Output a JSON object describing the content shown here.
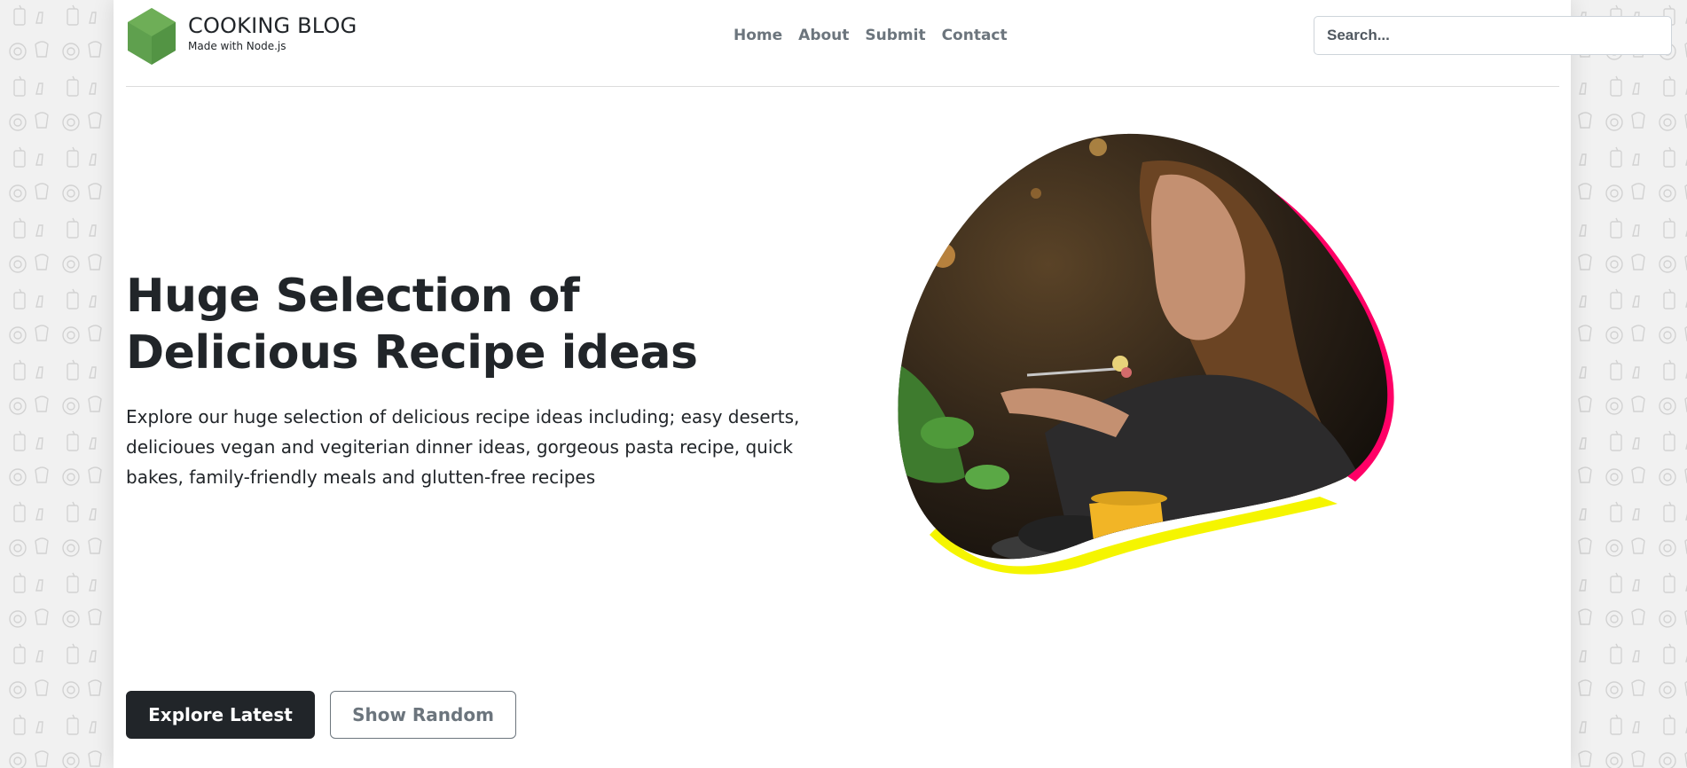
{
  "brand": {
    "title": "COOKING BLOG",
    "subtitle": "Made with Node.js",
    "logo_icon": "hexagon-logo-icon",
    "logo_color": "#5fa04e"
  },
  "nav": {
    "items": [
      {
        "label": "Home"
      },
      {
        "label": "About"
      },
      {
        "label": "Submit"
      },
      {
        "label": "Contact"
      }
    ]
  },
  "search": {
    "placeholder": "Search..."
  },
  "hero": {
    "title": "Huge Selection of Delicious Recipe ideas",
    "description": "Explore our huge selection of delicious recipe ideas including; easy deserts, delicioues vegan and vegiterian dinner ideas, gorgeous pasta recipe, quick bakes, family-friendly meals and glutten-free recipes",
    "image_icon": "woman-eating-photo",
    "accent_pink": "#ff0066",
    "accent_yellow": "#f5f500"
  },
  "actions": {
    "primary_label": "Explore Latest",
    "secondary_label": "Show Random",
    "primary_color": "#212529"
  },
  "background": {
    "pattern_icon": "food-doodle-pattern",
    "color": "#f1f1f1"
  }
}
